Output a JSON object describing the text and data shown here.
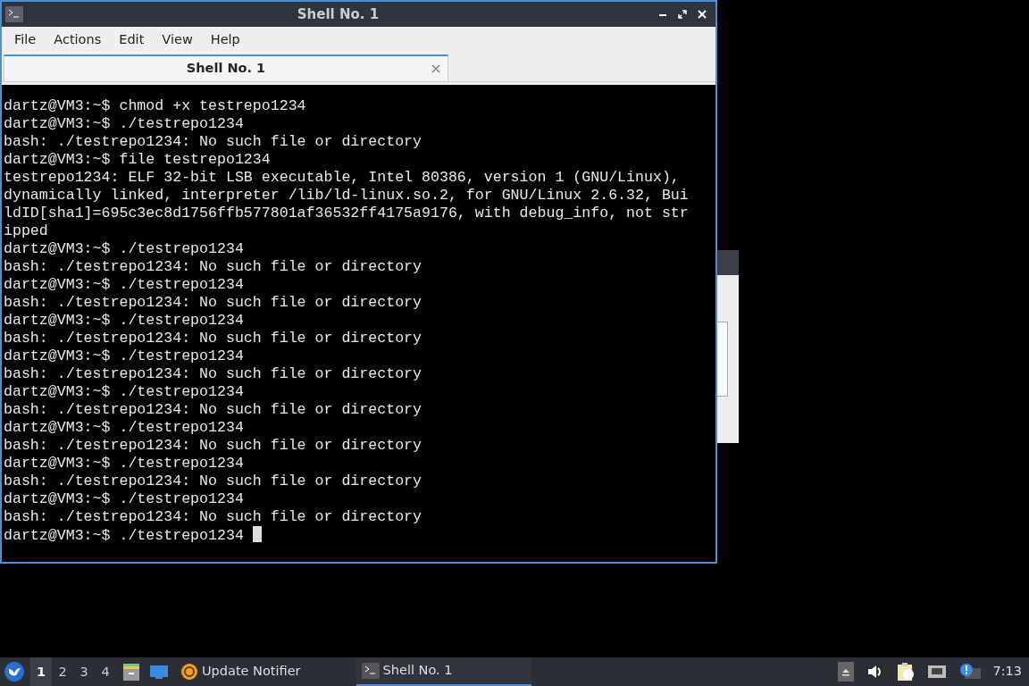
{
  "window": {
    "title": "Shell No. 1"
  },
  "menu": [
    "File",
    "Actions",
    "Edit",
    "View",
    "Help"
  ],
  "tabs": [
    {
      "label": "Shell No. 1",
      "selected": true
    }
  ],
  "terminal": {
    "lines": [
      "dartz@VM3:~$ chmod +x testrepo1234",
      "dartz@VM3:~$ ./testrepo1234",
      "bash: ./testrepo1234: No such file or directory",
      "dartz@VM3:~$ file testrepo1234",
      "testrepo1234: ELF 32-bit LSB executable, Intel 80386, version 1 (GNU/Linux),",
      "dynamically linked, interpreter /lib/ld-linux.so.2, for GNU/Linux 2.6.32, Bui",
      "ldID[sha1]=695c3ec8d1756ffb577801af36532ff4175a9176, with debug_info, not str",
      "ipped",
      "dartz@VM3:~$ ./testrepo1234",
      "bash: ./testrepo1234: No such file or directory",
      "dartz@VM3:~$ ./testrepo1234",
      "bash: ./testrepo1234: No such file or directory",
      "dartz@VM3:~$ ./testrepo1234",
      "bash: ./testrepo1234: No such file or directory",
      "dartz@VM3:~$ ./testrepo1234",
      "bash: ./testrepo1234: No such file or directory",
      "dartz@VM3:~$ ./testrepo1234",
      "bash: ./testrepo1234: No such file or directory",
      "dartz@VM3:~$ ./testrepo1234",
      "bash: ./testrepo1234: No such file or directory",
      "dartz@VM3:~$ ./testrepo1234",
      "bash: ./testrepo1234: No such file or directory",
      "dartz@VM3:~$ ./testrepo1234",
      "bash: ./testrepo1234: No such file or directory",
      "dartz@VM3:~$ ./testrepo1234 "
    ],
    "cursor": true
  },
  "taskbar": {
    "desktops": [
      {
        "label": "1",
        "selected": true
      },
      {
        "label": "2",
        "selected": false
      },
      {
        "label": "3",
        "selected": false
      },
      {
        "label": "4",
        "selected": false
      }
    ],
    "tasks": [
      {
        "label": "Update Notifier",
        "kind": "notifier",
        "selected": false
      },
      {
        "label": "Shell No. 1",
        "kind": "terminal",
        "selected": true
      }
    ],
    "clock": "7:13"
  }
}
